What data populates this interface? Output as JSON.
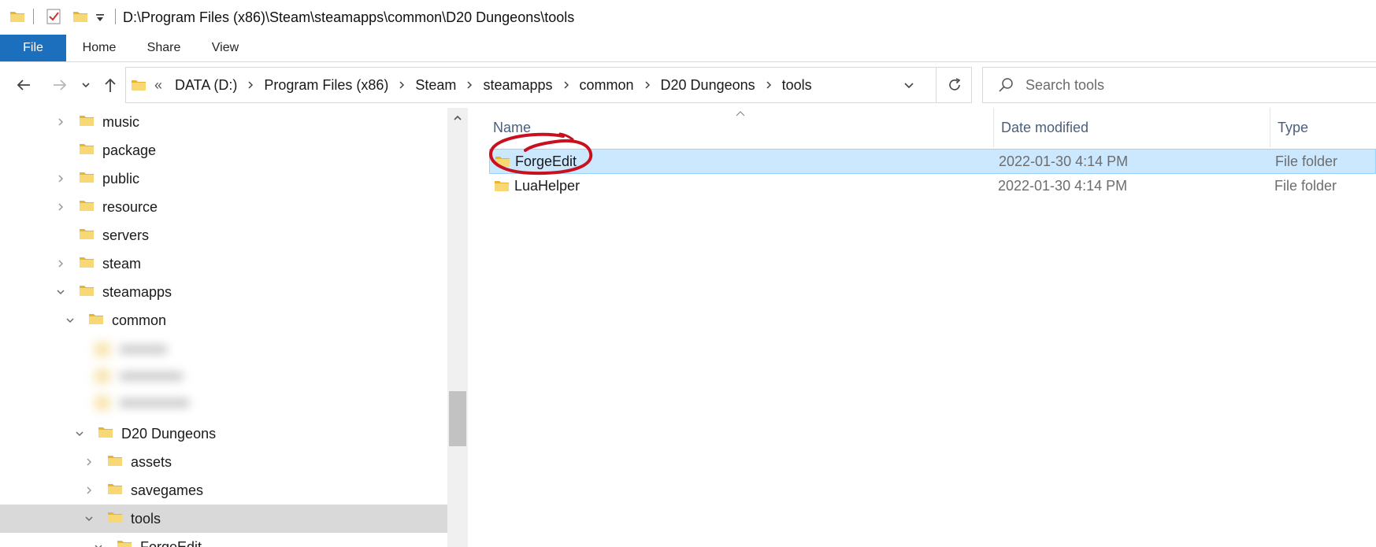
{
  "window": {
    "title": "D:\\Program Files (x86)\\Steam\\steamapps\\common\\D20 Dungeons\\tools"
  },
  "quick_access": {
    "icons": [
      "folder-icon",
      "properties-check-icon",
      "new-folder-icon",
      "customize-dropdown-icon"
    ]
  },
  "ribbon": {
    "tabs": [
      "File",
      "Home",
      "Share",
      "View"
    ],
    "active": "File",
    "active_color": "#1c6fbd"
  },
  "address_bar": {
    "overflow": "«",
    "crumbs": [
      "DATA (D:)",
      "Program Files (x86)",
      "Steam",
      "steamapps",
      "common",
      "D20 Dungeons",
      "tools"
    ]
  },
  "search": {
    "placeholder": "Search tools"
  },
  "nav_tree": {
    "items": [
      {
        "label": "music",
        "chevron": "right"
      },
      {
        "label": "package",
        "chevron": "none"
      },
      {
        "label": "public",
        "chevron": "right"
      },
      {
        "label": "resource",
        "chevron": "right"
      },
      {
        "label": "servers",
        "chevron": "none"
      },
      {
        "label": "steam",
        "chevron": "right"
      },
      {
        "label": "steamapps",
        "chevron": "down"
      },
      {
        "label": "common",
        "chevron": "down"
      },
      {
        "label": "D20 Dungeons",
        "chevron": "down"
      },
      {
        "label": "assets",
        "chevron": "right"
      },
      {
        "label": "savegames",
        "chevron": "right"
      },
      {
        "label": "tools",
        "chevron": "down",
        "selected": true
      },
      {
        "label": "ForgeEdit",
        "chevron": "down"
      }
    ]
  },
  "file_list": {
    "columns": [
      "Name",
      "Date modified",
      "Type"
    ],
    "rows": [
      {
        "name": "ForgeEdit",
        "date": "2022-01-30 4:14 PM",
        "type": "File folder",
        "selected": true
      },
      {
        "name": "LuaHelper",
        "date": "2022-01-30 4:14 PM",
        "type": "File folder"
      }
    ]
  },
  "colors": {
    "selection_bg": "#cce8ff",
    "nav_selected_bg": "#d9d9d9",
    "annotation_circle": "#c8101e",
    "folder": "#f4c84d"
  }
}
